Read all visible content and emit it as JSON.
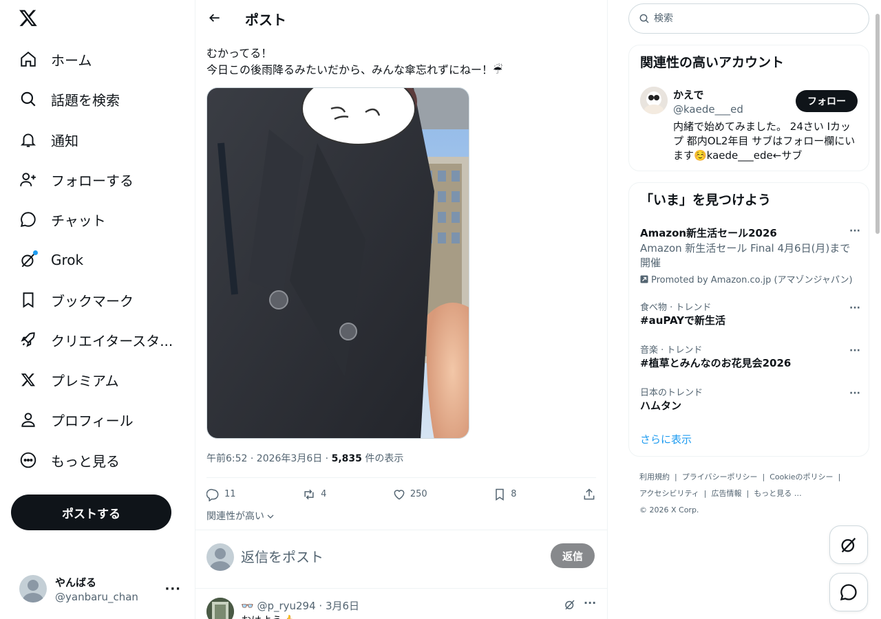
{
  "nav": {
    "items": [
      {
        "label": "ホーム",
        "icon": "home-icon"
      },
      {
        "label": "話題を検索",
        "icon": "search-icon"
      },
      {
        "label": "通知",
        "icon": "bell-icon"
      },
      {
        "label": "フォローする",
        "icon": "person-add-icon"
      },
      {
        "label": "チャット",
        "icon": "chat-icon"
      },
      {
        "label": "Grok",
        "icon": "grok-icon"
      },
      {
        "label": "ブックマーク",
        "icon": "bookmark-icon"
      },
      {
        "label": "クリエイタースタ...",
        "icon": "rocket-icon"
      },
      {
        "label": "プレミアム",
        "icon": "x-icon"
      },
      {
        "label": "プロフィール",
        "icon": "profile-icon"
      },
      {
        "label": "もっと見る",
        "icon": "more-circle-icon"
      }
    ],
    "post_button": "ポストする",
    "account": {
      "name": "やんばる",
      "handle": "@yanbaru_chan"
    }
  },
  "main": {
    "title": "ポスト",
    "tweet": {
      "line1": "むかってる！",
      "line2": "今日この後雨降るみたいだから、みんな傘忘れずにねー！☔"
    },
    "meta": {
      "time": "午前6:52 · 2026年3月6日 · ",
      "views": "5,835",
      "views_suffix": " 件の表示"
    },
    "actions": {
      "replies": "11",
      "reposts": "4",
      "likes": "250",
      "bookmarks": "8"
    },
    "relevance": "関連性が高い",
    "reply_placeholder": "返信をポスト",
    "reply_button": "返信",
    "first_reply": {
      "header": "👓 @p_ryu294 · 3月6日",
      "text": "おはよう👍"
    }
  },
  "right": {
    "search_placeholder": "検索",
    "who_to_follow": {
      "title": "関連性の高いアカウント",
      "name": "かえで",
      "handle": "@kaede___ed",
      "follow": "フォロー",
      "bio": "内緒で始めてみました。 24さい Iカップ 都内OL2年目 サブはフォロー欄にいます☺️kaede___ede←サブ"
    },
    "trends": {
      "title": "「いま」を見つけよう",
      "items": [
        {
          "category": "",
          "title": "Amazon新生活セール2026",
          "desc": "Amazon 新生活セール Final 4月6日(月)まで開催",
          "promo": "Promoted by Amazon.co.jp (アマゾンジャパン)"
        },
        {
          "category": "食べ物 · トレンド",
          "title": "#auPAYで新生活"
        },
        {
          "category": "音楽 · トレンド",
          "title": "#植草とみんなのお花見会2026"
        },
        {
          "category": "日本のトレンド",
          "title": "ハムタン"
        }
      ],
      "show_more": "さらに表示"
    },
    "footer": {
      "links": [
        "利用規約",
        "プライバシーポリシー",
        "Cookieのポリシー",
        "アクセシビリティ",
        "広告情報",
        "もっと見る …"
      ],
      "copyright": "© 2026 X Corp."
    }
  }
}
